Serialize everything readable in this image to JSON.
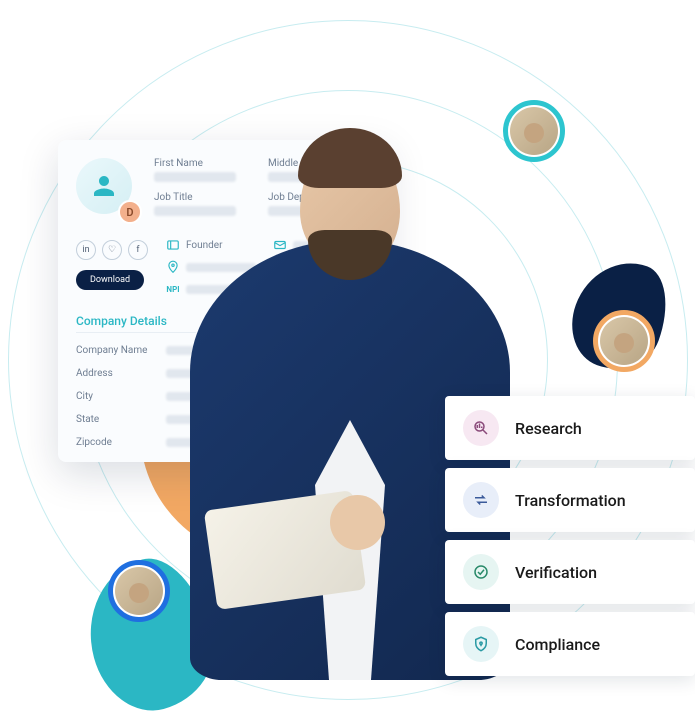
{
  "profile": {
    "badge": "D",
    "fields": {
      "firstName": {
        "label": "First Name"
      },
      "middleName": {
        "label": "Middle Name"
      },
      "jobTitle": {
        "label": "Job Title"
      },
      "jobDept": {
        "label": "Job Department"
      }
    },
    "downloadLabel": "Download",
    "contactRows": {
      "founder": "Founder",
      "npi": "NPI"
    },
    "section": "Company Details",
    "details": {
      "companyName": "Company Name",
      "address": "Address",
      "city": "City",
      "state": "State",
      "zipcode": "Zipcode"
    }
  },
  "features": [
    {
      "label": "Research"
    },
    {
      "label": "Transformation"
    },
    {
      "label": "Verification"
    },
    {
      "label": "Compliance"
    }
  ]
}
